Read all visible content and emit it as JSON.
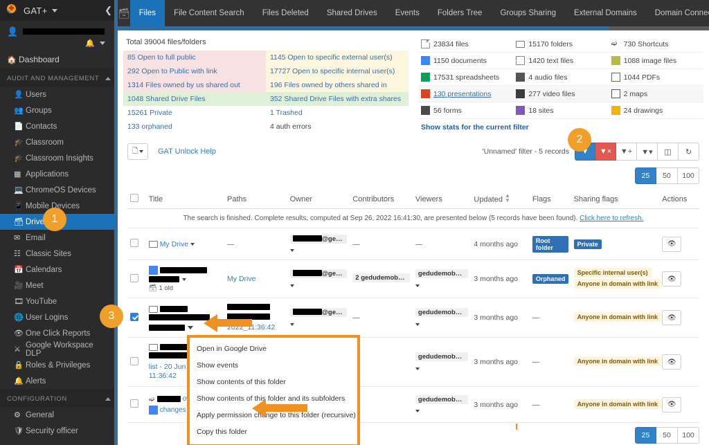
{
  "app": {
    "brand": "GAT+",
    "collapse_icon": "chevron-left-icon",
    "user_menu_icons": [
      "bell-icon",
      "chevron-down-icon"
    ]
  },
  "sidebar": {
    "dashboard": {
      "label": "Dashboard",
      "icon": "home-icon"
    },
    "sections": [
      {
        "title": "AUDIT AND MANAGEMENT",
        "items": [
          {
            "label": "Users",
            "icon": "user-icon"
          },
          {
            "label": "Groups",
            "icon": "groups-icon"
          },
          {
            "label": "Contacts",
            "icon": "contact-card-icon"
          },
          {
            "label": "Classroom",
            "icon": "graduation-cap-icon"
          },
          {
            "label": "Classroom Insights",
            "icon": "graduation-search-icon"
          },
          {
            "label": "Applications",
            "icon": "grid-apps-icon"
          },
          {
            "label": "ChromeOS Devices",
            "icon": "laptop-icon"
          },
          {
            "label": "Mobile Devices",
            "icon": "phone-icon"
          },
          {
            "label": "Drive",
            "icon": "drive-icon",
            "active": true
          },
          {
            "label": "Email",
            "icon": "envelope-icon"
          },
          {
            "label": "Classic Sites",
            "icon": "sitemap-icon"
          },
          {
            "label": "Calendars",
            "icon": "calendar-icon"
          },
          {
            "label": "Meet",
            "icon": "video-camera-icon"
          },
          {
            "label": "YouTube",
            "icon": "film-icon"
          },
          {
            "label": "User Logins",
            "icon": "globe-icon"
          },
          {
            "label": "One Click Reports",
            "icon": "eye-icon"
          },
          {
            "label": "Google Workspace DLP",
            "icon": "flask-icon"
          },
          {
            "label": "Roles & Privileges",
            "icon": "lock-icon"
          },
          {
            "label": "Alerts",
            "icon": "bell-icon"
          }
        ]
      },
      {
        "title": "CONFIGURATION",
        "items": [
          {
            "label": "General",
            "icon": "gears-icon"
          },
          {
            "label": "Security officer",
            "icon": "shield-icon"
          }
        ]
      }
    ]
  },
  "topbar": {
    "section_icon": "drive-icon",
    "tabs": [
      {
        "label": "Files",
        "active": true
      },
      {
        "label": "File Content Search"
      },
      {
        "label": "Files Deleted"
      },
      {
        "label": "Shared Drives"
      },
      {
        "label": "Events"
      },
      {
        "label": "Folders Tree"
      },
      {
        "label": "Groups Sharing"
      },
      {
        "label": "External Domains"
      },
      {
        "label": "Domain Connection Graph"
      }
    ]
  },
  "stats": {
    "total": "Total 39004 files/folders",
    "left_rows": [
      {
        "bg": "pink",
        "left": "85 Open to full public",
        "right": "1145 Open to specific external user(s)",
        "right_bg": "cream"
      },
      {
        "bg": "pink",
        "left": "292 Open to Public with link",
        "right": "17727 Open to specific internal user(s)",
        "right_bg": "cream"
      },
      {
        "bg": "pink",
        "left": "1314 Files owned by us shared out",
        "right": "196 Files owned by others shared in",
        "right_bg": "cream"
      },
      {
        "bg": "green",
        "left": "1048 Shared Drive Files",
        "right": "352 Shared Drive Files with extra shares",
        "right_bg": "green"
      },
      {
        "bg": "none",
        "left": "15261 Private",
        "right": "1 Trashed",
        "right_bg": "none"
      },
      {
        "bg": "none",
        "left": "133 orphaned",
        "right": "4 auth errors",
        "right_bg": "none",
        "dark": true
      }
    ],
    "right_rows": [
      [
        {
          "label": "23834 files",
          "icon": "file-icon",
          "cls": "doc"
        },
        {
          "label": "15170 folders",
          "icon": "folder-icon",
          "cls": "folder"
        },
        {
          "label": "730 Shortcuts",
          "icon": "shortcut-arrow-icon",
          "cls": "shortcut"
        }
      ],
      [
        {
          "label": "1150 documents",
          "icon": "google-docs-icon",
          "cls": "gdoc"
        },
        {
          "label": "1420 text files",
          "icon": "text-file-icon",
          "cls": "txt"
        },
        {
          "label": "1088 image files",
          "icon": "image-icon",
          "cls": "img"
        }
      ],
      [
        {
          "label": "17531 spreadsheets",
          "icon": "google-sheets-icon",
          "cls": "sheet"
        },
        {
          "label": "4 audio files",
          "icon": "audio-file-icon",
          "cls": "audio"
        },
        {
          "label": "1044 PDFs",
          "icon": "pdf-icon",
          "cls": "pdf"
        }
      ],
      [
        {
          "label": "130 presentations",
          "icon": "google-slides-icon",
          "cls": "slide",
          "link": true
        },
        {
          "label": "277 video files",
          "icon": "video-file-icon",
          "cls": "video"
        },
        {
          "label": "2 maps",
          "icon": "map-icon",
          "cls": "map"
        }
      ],
      [
        {
          "label": "56 forms",
          "icon": "google-forms-icon",
          "cls": "form"
        },
        {
          "label": "18 sites",
          "icon": "google-sites-icon",
          "cls": "site"
        },
        {
          "label": "24 drawings",
          "icon": "google-drawings-icon",
          "cls": "draw"
        }
      ]
    ],
    "show_stats_link": "Show stats for the current filter"
  },
  "toolbar": {
    "export_icon": "export-file-icon",
    "unlock_help": "GAT Unlock Help",
    "filter_status": "'Unnamed' filter -  5 records",
    "buttons": [
      {
        "name": "apply-filter-button",
        "icon": "funnel-icon",
        "style": "blue"
      },
      {
        "name": "clear-filter-button",
        "icon": "funnel-x-icon",
        "style": "red"
      },
      {
        "name": "save-filter-button",
        "icon": "funnel-save-icon",
        "style": "plain"
      },
      {
        "name": "bulk-action-button",
        "icon": "person-action-icon",
        "style": "plain",
        "caret": true
      },
      {
        "name": "columns-button",
        "icon": "columns-icon",
        "style": "plain"
      },
      {
        "name": "refresh-button",
        "icon": "refresh-icon",
        "style": "plain"
      }
    ]
  },
  "pagination": {
    "options": [
      "25",
      "50",
      "100"
    ],
    "selected": "25"
  },
  "table": {
    "columns": [
      "Title",
      "Paths",
      "Owner",
      "Contributors",
      "Viewers",
      "Updated",
      "Flags",
      "Sharing flags",
      "Actions"
    ],
    "sort_column": "Updated",
    "search_note": "The search is finished. Complete results, computed at Sep 26, 2022 16:41:30, are presented below (5 records have been found).",
    "search_note_link": "Click here to refresh.",
    "rows": [
      {
        "checked": false,
        "title": "My Drive",
        "title_icon": "folder-icon",
        "title_redacted": false,
        "paths": "—",
        "owner_chip": "@gedudem...",
        "owner_redacted": true,
        "contributors": "—",
        "viewers": "—",
        "updated": "4 months ago",
        "flags": [
          "Root folder"
        ],
        "flag_style": "blue",
        "sharing_flags": [
          "Private"
        ],
        "sharing_style": "blue",
        "action_icon": "eye-icon"
      },
      {
        "checked": false,
        "title": "",
        "title_icon": "google-docs-icon",
        "title_redacted": true,
        "title_sub": "1 old",
        "title_sub_icon": "archive-icon",
        "paths": "My Drive",
        "paths_link": true,
        "owner_chip": "@gedudem...",
        "owner_redacted": true,
        "contributors": "2 gedudemobsn.com",
        "viewers": "gedudemobsn.com (...",
        "updated": "3 months ago",
        "flags": [
          "Orphaned"
        ],
        "flag_style": "blue",
        "sharing_flags": [
          "Specific internal user(s)",
          "Anyone in domain with link"
        ],
        "sharing_style": "cream",
        "action_icon": "eye-icon"
      },
      {
        "checked": true,
        "title": "",
        "title_icon": "folder-icon",
        "title_redacted": true,
        "paths": "2022_11:36:42",
        "paths_redacted": true,
        "owner_chip": "@gedudem...",
        "owner_redacted": true,
        "contributors": "—",
        "viewers": "gedudemobsn.com (...",
        "updated": "3 months ago",
        "flags": [
          "—"
        ],
        "flag_style": "none",
        "sharing_flags": [
          "Anyone in domain with link"
        ],
        "sharing_style": "cream",
        "action_icon": "eye-icon"
      },
      {
        "checked": false,
        "title": "list - 20 Jun 2022 11:36:42",
        "title_icon": "folder-icon",
        "title_redacted": true,
        "paths": "",
        "owner_chip": "",
        "contributors": "",
        "viewers": "gedudemobsn.com (...",
        "updated": "3 months ago",
        "flags": [
          "—"
        ],
        "flag_style": "none",
        "sharing_flags": [
          "Anyone in domain with link"
        ],
        "sharing_style": "cream",
        "action_icon": "eye-icon"
      },
      {
        "checked": false,
        "title": "owner changes",
        "title_icon": "shortcut-arrow-icon",
        "title_icon2": "google-docs-icon",
        "title_redacted": true,
        "paths": "",
        "owner_chip": "",
        "contributors": "",
        "viewers": "gedudemobsn.com (...",
        "updated": "3 months ago",
        "flags": [
          "—"
        ],
        "flag_style": "none",
        "sharing_flags": [
          "Anyone in domain with link"
        ],
        "sharing_style": "cream",
        "action_icon": "eye-icon"
      }
    ]
  },
  "context_menu": {
    "items": [
      "Open in Google Drive",
      "Show events",
      "Show contents of this folder",
      "Show contents of this folder and its subfolders",
      "Apply permission change to this folder (recursive)",
      "Copy this folder"
    ]
  },
  "callouts": [
    {
      "number": "1"
    },
    {
      "number": "2"
    },
    {
      "number": "3"
    }
  ],
  "colors": {
    "accent_blue": "#1a73b8",
    "callout_orange": "#f0a029",
    "highlight_orange": "#ef9021",
    "sidebar_bg": "#2b2b2b",
    "danger_red": "#e05a52"
  }
}
